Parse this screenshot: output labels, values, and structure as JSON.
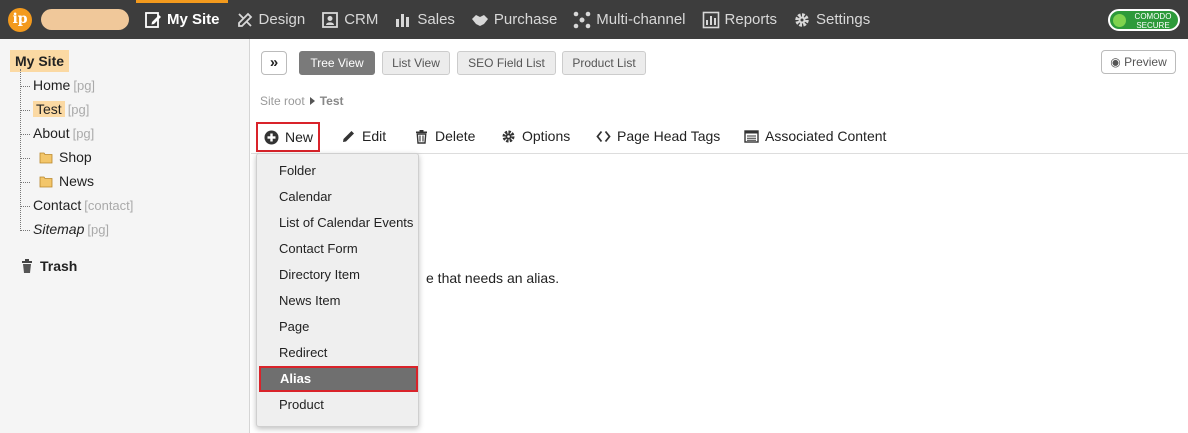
{
  "topnav": {
    "items": [
      {
        "label": "My Site"
      },
      {
        "label": "Design"
      },
      {
        "label": "CRM"
      },
      {
        "label": "Sales"
      },
      {
        "label": "Purchase"
      },
      {
        "label": "Multi-channel"
      },
      {
        "label": "Reports"
      },
      {
        "label": "Settings"
      }
    ],
    "logo_text": "ip",
    "secure_line1": "COMODO",
    "secure_line2": "SECURE"
  },
  "sidebar": {
    "root": "My Site",
    "nodes": [
      {
        "label": "Home",
        "tag": "[pg]"
      },
      {
        "label": "Test",
        "tag": "[pg]"
      },
      {
        "label": "About",
        "tag": "[pg]"
      },
      {
        "label": "Shop",
        "tag": ""
      },
      {
        "label": "News",
        "tag": ""
      },
      {
        "label": "Contact",
        "tag": "[contact]"
      },
      {
        "label": "Sitemap",
        "tag": "[pg]"
      }
    ],
    "trash": "Trash"
  },
  "main": {
    "expand": "»",
    "view_tabs": [
      "Tree View",
      "List View",
      "SEO Field List",
      "Product List"
    ],
    "preview": "Preview",
    "breadcrumb": {
      "root": "Site root",
      "current": "Test"
    },
    "toolbar": {
      "new": "New",
      "edit": "Edit",
      "delete": "Delete",
      "options": "Options",
      "page_head_tags": "Page Head Tags",
      "associated_content": "Associated Content"
    },
    "body_text": "e that needs an alias."
  },
  "new_menu": {
    "items": [
      "Folder",
      "Calendar",
      "List of Calendar Events",
      "Contact Form",
      "Directory Item",
      "News Item",
      "Page",
      "Redirect",
      "Alias",
      "Product"
    ],
    "selected": "Alias"
  },
  "colors": {
    "accent": "#f39a1d",
    "highlight": "#fbd9a3",
    "callout": "#d9232a",
    "topbar": "#3d3d3d"
  }
}
